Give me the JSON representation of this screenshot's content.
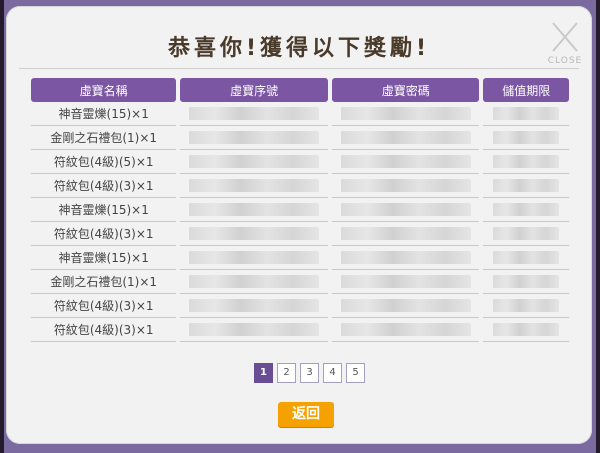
{
  "dialog": {
    "title": "恭喜你!獲得以下獎勵!",
    "close_label": "CLOSE"
  },
  "table": {
    "headers": [
      "虛寶名稱",
      "虛寶序號",
      "虛寶密碼",
      "儲值期限"
    ],
    "rows": [
      {
        "name": "神音靈爍(15)×1"
      },
      {
        "name": "金剛之石禮包(1)×1"
      },
      {
        "name": "符紋包(4級)(5)×1"
      },
      {
        "name": "符紋包(4級)(3)×1"
      },
      {
        "name": "神音靈爍(15)×1"
      },
      {
        "name": "符紋包(4級)(3)×1"
      },
      {
        "name": "神音靈爍(15)×1"
      },
      {
        "name": "金剛之石禮包(1)×1"
      },
      {
        "name": "符紋包(4級)(3)×1"
      },
      {
        "name": "符紋包(4級)(3)×1"
      }
    ]
  },
  "pagination": {
    "pages": [
      "1",
      "2",
      "3",
      "4",
      "5"
    ],
    "current": "1"
  },
  "footer": {
    "back_label": "返回"
  },
  "colors": {
    "header_purple": "#7b57a3",
    "frame_purple": "#7b6aa0",
    "back_orange": "#f5a100"
  }
}
